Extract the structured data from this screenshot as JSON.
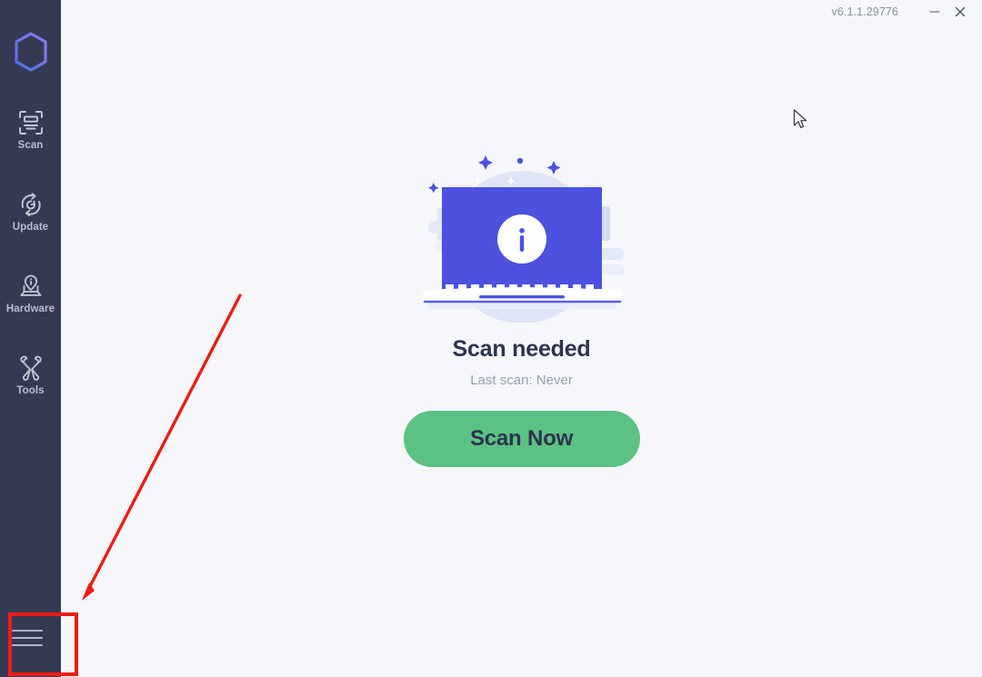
{
  "window": {
    "version_label": "v6.1.1.29776",
    "minimize_icon": "minimize-icon",
    "close_icon": "close-icon"
  },
  "sidebar": {
    "logo_icon": "app-logo-hexagon-icon",
    "items": [
      {
        "label": "Scan",
        "icon": "scan-icon"
      },
      {
        "label": "Update",
        "icon": "update-refresh-icon"
      },
      {
        "label": "Hardware",
        "icon": "hardware-laptop-icon"
      },
      {
        "label": "Tools",
        "icon": "tools-wrench-screwdriver-icon"
      }
    ],
    "menu_icon": "hamburger-menu-icon"
  },
  "main": {
    "illustration_icon": "laptop-info-illustration",
    "status_title": "Scan needed",
    "status_subtitle": "Last scan: Never",
    "scan_button_label": "Scan Now"
  },
  "colors": {
    "sidebar_bg": "#353a54",
    "page_bg": "#f5f7fa",
    "accent_blue": "#4c51e0",
    "button_green": "#5cc283",
    "title_navy": "#2d3350",
    "muted_text": "#9a9fb2",
    "annotation_red": "#ee1b16"
  },
  "annotations": {
    "arrow_name": "red-pointer-arrow",
    "box_name": "red-highlight-box"
  }
}
